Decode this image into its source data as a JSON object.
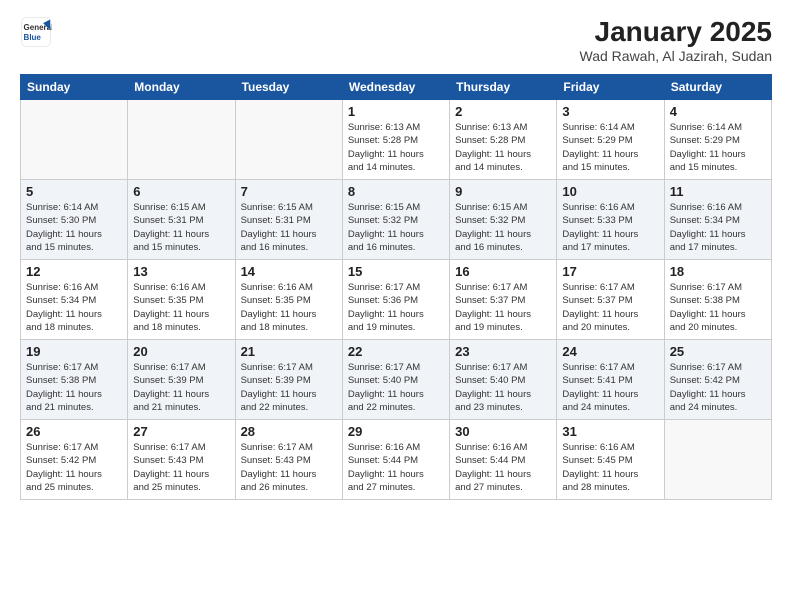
{
  "header": {
    "logo_general": "General",
    "logo_blue": "Blue",
    "month_title": "January 2025",
    "location": "Wad Rawah, Al Jazirah, Sudan"
  },
  "weekdays": [
    "Sunday",
    "Monday",
    "Tuesday",
    "Wednesday",
    "Thursday",
    "Friday",
    "Saturday"
  ],
  "weeks": [
    [
      {
        "day": "",
        "info": ""
      },
      {
        "day": "",
        "info": ""
      },
      {
        "day": "",
        "info": ""
      },
      {
        "day": "1",
        "info": "Sunrise: 6:13 AM\nSunset: 5:28 PM\nDaylight: 11 hours\nand 14 minutes."
      },
      {
        "day": "2",
        "info": "Sunrise: 6:13 AM\nSunset: 5:28 PM\nDaylight: 11 hours\nand 14 minutes."
      },
      {
        "day": "3",
        "info": "Sunrise: 6:14 AM\nSunset: 5:29 PM\nDaylight: 11 hours\nand 15 minutes."
      },
      {
        "day": "4",
        "info": "Sunrise: 6:14 AM\nSunset: 5:29 PM\nDaylight: 11 hours\nand 15 minutes."
      }
    ],
    [
      {
        "day": "5",
        "info": "Sunrise: 6:14 AM\nSunset: 5:30 PM\nDaylight: 11 hours\nand 15 minutes."
      },
      {
        "day": "6",
        "info": "Sunrise: 6:15 AM\nSunset: 5:31 PM\nDaylight: 11 hours\nand 15 minutes."
      },
      {
        "day": "7",
        "info": "Sunrise: 6:15 AM\nSunset: 5:31 PM\nDaylight: 11 hours\nand 16 minutes."
      },
      {
        "day": "8",
        "info": "Sunrise: 6:15 AM\nSunset: 5:32 PM\nDaylight: 11 hours\nand 16 minutes."
      },
      {
        "day": "9",
        "info": "Sunrise: 6:15 AM\nSunset: 5:32 PM\nDaylight: 11 hours\nand 16 minutes."
      },
      {
        "day": "10",
        "info": "Sunrise: 6:16 AM\nSunset: 5:33 PM\nDaylight: 11 hours\nand 17 minutes."
      },
      {
        "day": "11",
        "info": "Sunrise: 6:16 AM\nSunset: 5:34 PM\nDaylight: 11 hours\nand 17 minutes."
      }
    ],
    [
      {
        "day": "12",
        "info": "Sunrise: 6:16 AM\nSunset: 5:34 PM\nDaylight: 11 hours\nand 18 minutes."
      },
      {
        "day": "13",
        "info": "Sunrise: 6:16 AM\nSunset: 5:35 PM\nDaylight: 11 hours\nand 18 minutes."
      },
      {
        "day": "14",
        "info": "Sunrise: 6:16 AM\nSunset: 5:35 PM\nDaylight: 11 hours\nand 18 minutes."
      },
      {
        "day": "15",
        "info": "Sunrise: 6:17 AM\nSunset: 5:36 PM\nDaylight: 11 hours\nand 19 minutes."
      },
      {
        "day": "16",
        "info": "Sunrise: 6:17 AM\nSunset: 5:37 PM\nDaylight: 11 hours\nand 19 minutes."
      },
      {
        "day": "17",
        "info": "Sunrise: 6:17 AM\nSunset: 5:37 PM\nDaylight: 11 hours\nand 20 minutes."
      },
      {
        "day": "18",
        "info": "Sunrise: 6:17 AM\nSunset: 5:38 PM\nDaylight: 11 hours\nand 20 minutes."
      }
    ],
    [
      {
        "day": "19",
        "info": "Sunrise: 6:17 AM\nSunset: 5:38 PM\nDaylight: 11 hours\nand 21 minutes."
      },
      {
        "day": "20",
        "info": "Sunrise: 6:17 AM\nSunset: 5:39 PM\nDaylight: 11 hours\nand 21 minutes."
      },
      {
        "day": "21",
        "info": "Sunrise: 6:17 AM\nSunset: 5:39 PM\nDaylight: 11 hours\nand 22 minutes."
      },
      {
        "day": "22",
        "info": "Sunrise: 6:17 AM\nSunset: 5:40 PM\nDaylight: 11 hours\nand 22 minutes."
      },
      {
        "day": "23",
        "info": "Sunrise: 6:17 AM\nSunset: 5:40 PM\nDaylight: 11 hours\nand 23 minutes."
      },
      {
        "day": "24",
        "info": "Sunrise: 6:17 AM\nSunset: 5:41 PM\nDaylight: 11 hours\nand 24 minutes."
      },
      {
        "day": "25",
        "info": "Sunrise: 6:17 AM\nSunset: 5:42 PM\nDaylight: 11 hours\nand 24 minutes."
      }
    ],
    [
      {
        "day": "26",
        "info": "Sunrise: 6:17 AM\nSunset: 5:42 PM\nDaylight: 11 hours\nand 25 minutes."
      },
      {
        "day": "27",
        "info": "Sunrise: 6:17 AM\nSunset: 5:43 PM\nDaylight: 11 hours\nand 25 minutes."
      },
      {
        "day": "28",
        "info": "Sunrise: 6:17 AM\nSunset: 5:43 PM\nDaylight: 11 hours\nand 26 minutes."
      },
      {
        "day": "29",
        "info": "Sunrise: 6:16 AM\nSunset: 5:44 PM\nDaylight: 11 hours\nand 27 minutes."
      },
      {
        "day": "30",
        "info": "Sunrise: 6:16 AM\nSunset: 5:44 PM\nDaylight: 11 hours\nand 27 minutes."
      },
      {
        "day": "31",
        "info": "Sunrise: 6:16 AM\nSunset: 5:45 PM\nDaylight: 11 hours\nand 28 minutes."
      },
      {
        "day": "",
        "info": ""
      }
    ]
  ]
}
